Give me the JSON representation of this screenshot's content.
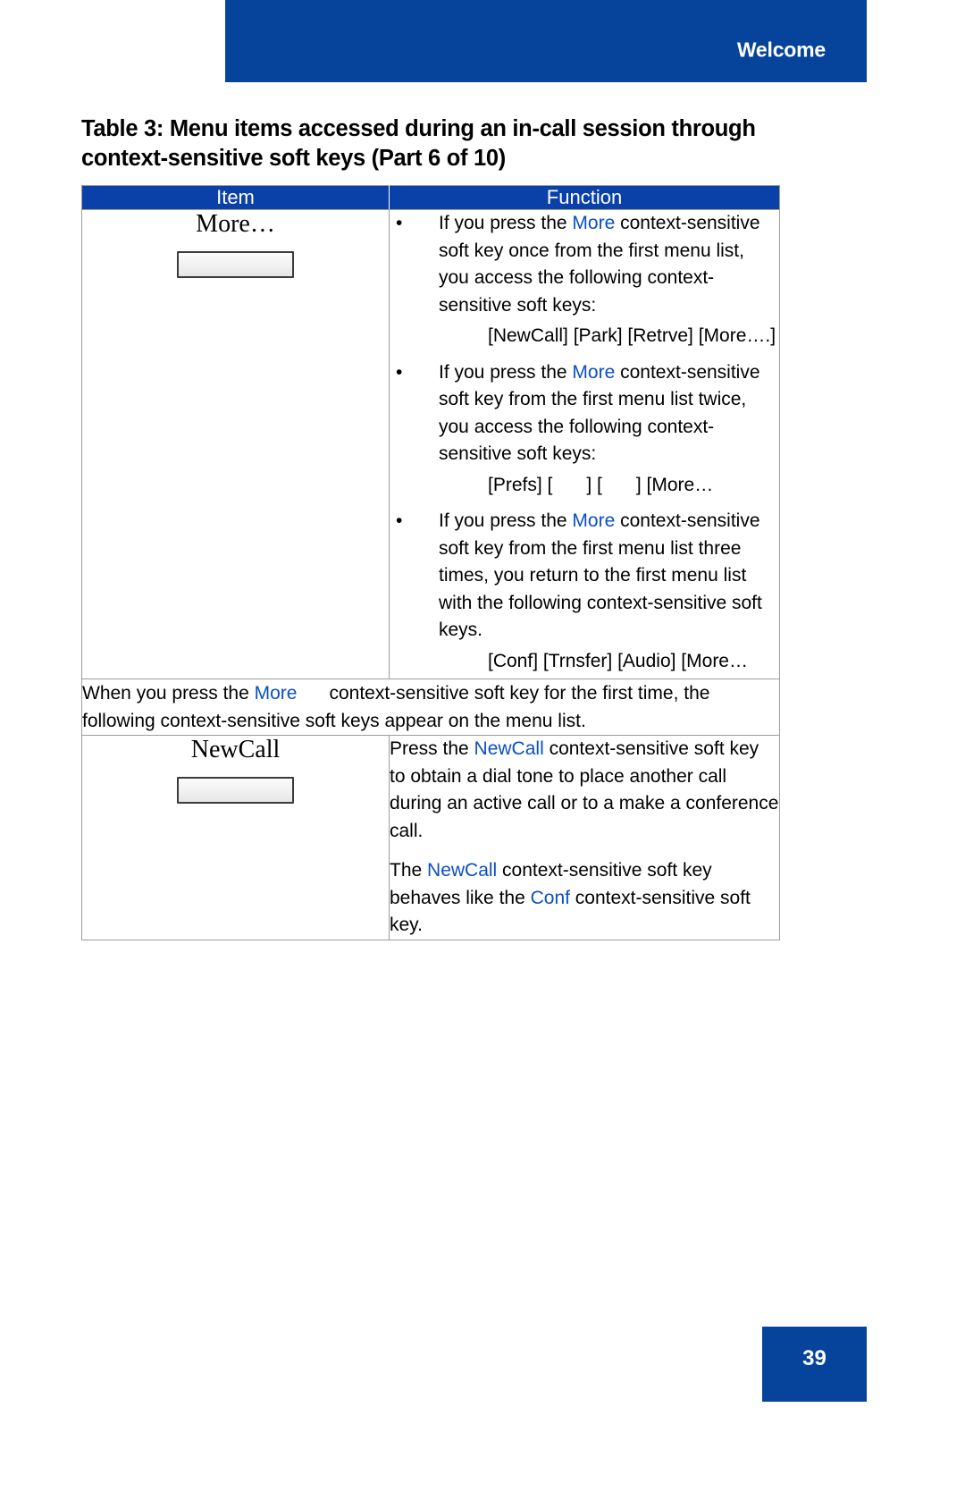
{
  "header": {
    "title": "Welcome"
  },
  "caption": {
    "text": "Table 3: Menu items accessed during an in-call session through context-sensitive soft keys (Part 6 of 10)"
  },
  "table": {
    "columns": {
      "item": "Item",
      "function": "Function"
    },
    "rows": [
      {
        "item_label": "More…",
        "item_has_softkey": true,
        "bullets": [
          {
            "prefix": "If you press the ",
            "link": "More",
            "suffix": " context-sensitive soft key once from the first menu list, you access the following context-sensitive soft keys:",
            "keys": "[NewCall] [Park] [Retrve] [More….]"
          },
          {
            "prefix": "If you press the ",
            "link": "More",
            "suffix": " context-sensitive soft key from the first menu list twice, you access the following context-sensitive soft keys:",
            "keys_pre": "[Prefs] [",
            "keys_mid": "] [",
            "keys_post": "] [More…"
          },
          {
            "prefix": "If you press the ",
            "link": "More",
            "suffix": " context-sensitive soft key from the first menu list three times, you return to the first menu list with the following context-sensitive soft keys.",
            "keys": "[Conf] [Trnsfer] [Audio] [More…"
          }
        ]
      }
    ],
    "note_row": {
      "prefix": "When you press the ",
      "link": "More",
      "suffix": "context-sensitive soft key for the first time, the following context-sensitive soft keys appear on the menu list."
    },
    "newcall_row": {
      "item_label": "NewCall",
      "item_has_softkey": true,
      "paragraph_1": {
        "prefix": "Press the ",
        "link": "NewCall",
        "suffix": " context-sensitive soft key to obtain a dial tone to place another call during an active call or to a make a conference call."
      },
      "paragraph_2": {
        "prefix": "The ",
        "link_1": "NewCall",
        "middle": " context-sensitive soft key behaves like the ",
        "link_2": "Conf",
        "suffix": " context-sensitive soft key."
      }
    }
  },
  "footer": {
    "page_number": "39"
  },
  "colors": {
    "banner_blue": "#06439b",
    "header_blue": "#0a41a8",
    "link_blue": "#0b4fc4",
    "border_gray": "#9d9d9d"
  }
}
